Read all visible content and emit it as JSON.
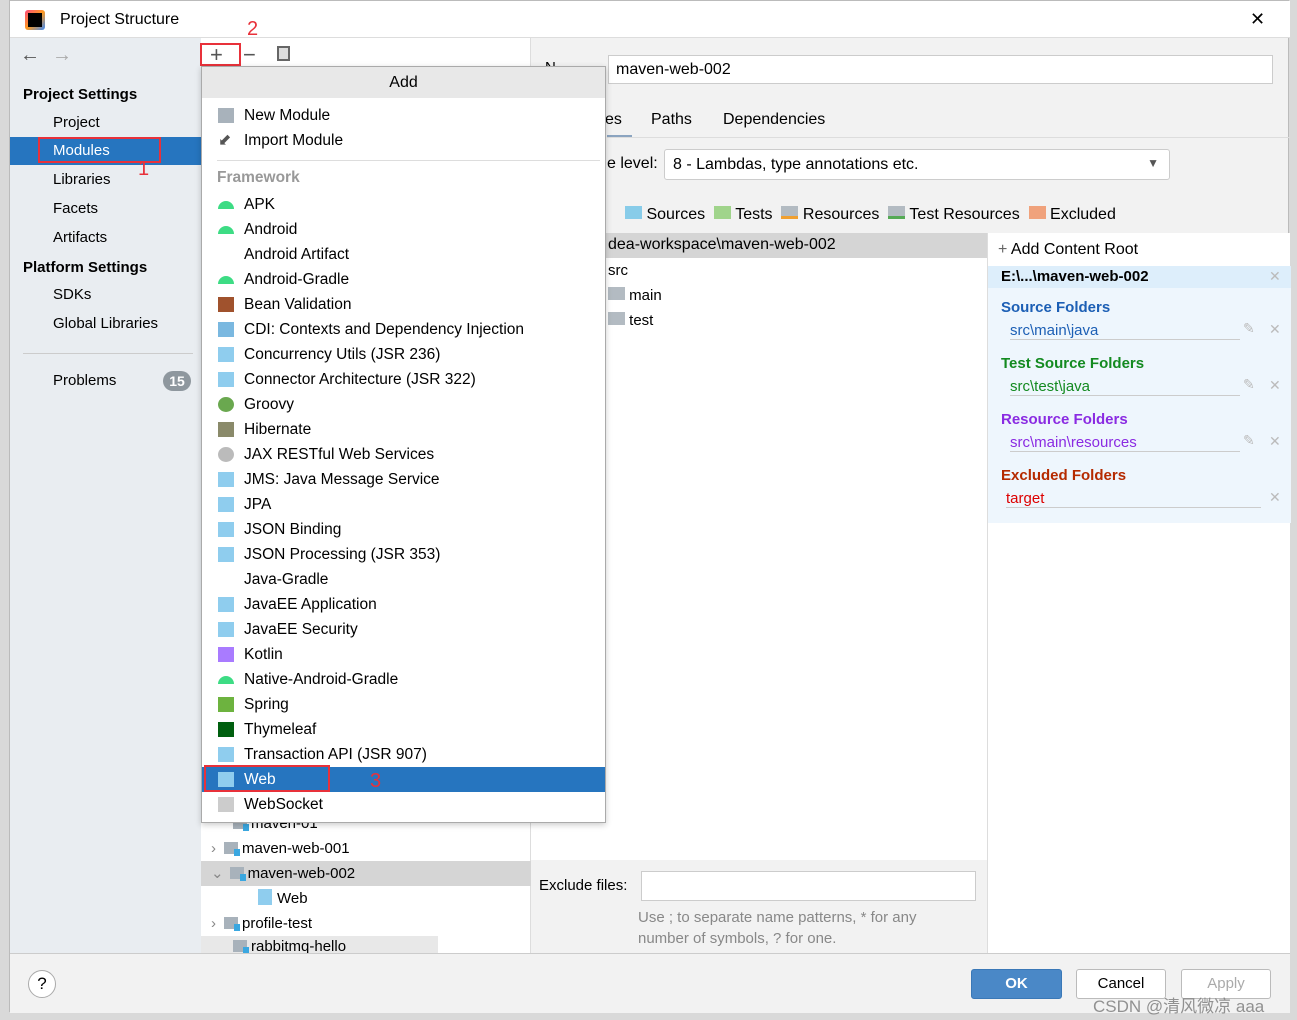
{
  "window": {
    "title": "Project Structure",
    "close": "✕"
  },
  "sidebar": {
    "project_settings": "Project Settings",
    "items": [
      "Project",
      "Modules",
      "Libraries",
      "Facets",
      "Artifacts"
    ],
    "platform_settings": "Platform Settings",
    "platform_items": [
      "SDKs",
      "Global Libraries"
    ],
    "problems": "Problems",
    "problems_count": "15",
    "selected": "Modules"
  },
  "toolbar": {
    "add": "+",
    "remove": "−",
    "copy": "copy"
  },
  "annotations": [
    "1",
    "2",
    "3"
  ],
  "popup": {
    "title": "Add",
    "top_items": [
      "New Module",
      "Import Module"
    ],
    "section": "Framework",
    "items": [
      {
        "label": "APK",
        "icon": "android-icon"
      },
      {
        "label": "Android",
        "icon": "android-icon"
      },
      {
        "label": "Android Artifact",
        "icon": ""
      },
      {
        "label": "Android-Gradle",
        "icon": "android-icon"
      },
      {
        "label": "Bean Validation",
        "icon": "bean-icon"
      },
      {
        "label": "CDI: Contexts and Dependency Injection",
        "icon": "cdi-icon"
      },
      {
        "label": "Concurrency Utils (JSR 236)",
        "icon": "javaee-icon"
      },
      {
        "label": "Connector Architecture (JSR 322)",
        "icon": "javaee-icon"
      },
      {
        "label": "Groovy",
        "icon": "groovy-icon"
      },
      {
        "label": "Hibernate",
        "icon": "hibernate-icon"
      },
      {
        "label": "JAX RESTful Web Services",
        "icon": "globe-icon"
      },
      {
        "label": "JMS: Java Message Service",
        "icon": "javaee-icon"
      },
      {
        "label": "JPA",
        "icon": "jpa-icon"
      },
      {
        "label": "JSON Binding",
        "icon": "javaee-icon"
      },
      {
        "label": "JSON Processing (JSR 353)",
        "icon": "javaee-icon"
      },
      {
        "label": "Java-Gradle",
        "icon": ""
      },
      {
        "label": "JavaEE Application",
        "icon": "javaee-icon"
      },
      {
        "label": "JavaEE Security",
        "icon": "javaee-icon"
      },
      {
        "label": "Kotlin",
        "icon": "kotlin-icon"
      },
      {
        "label": "Native-Android-Gradle",
        "icon": "android-icon"
      },
      {
        "label": "Spring",
        "icon": "spring-icon"
      },
      {
        "label": "Thymeleaf",
        "icon": "thymeleaf-icon"
      },
      {
        "label": "Transaction API (JSR 907)",
        "icon": "javaee-icon"
      },
      {
        "label": "Web",
        "icon": "web-icon"
      },
      {
        "label": "WebSocket",
        "icon": "websocket-icon"
      }
    ],
    "selected": "Web"
  },
  "tree": {
    "items": [
      "maven-01",
      "maven-web-001",
      "maven-web-002",
      "Web",
      "profile-test",
      "rabbitmq-hello"
    ]
  },
  "details": {
    "name_label": "N",
    "name_value": "maven-web-002",
    "tabs": [
      "es",
      "Paths",
      "Dependencies"
    ],
    "language_level_label": "e level:",
    "language_level_value": "8 - Lambdas, type annotations etc.",
    "mark_as": [
      "Sources",
      "Tests",
      "Resources",
      "Test Resources",
      "Excluded"
    ],
    "root_path": "dea-workspace\\maven-web-002",
    "folders": [
      "src",
      "main",
      "test"
    ],
    "exclude_label": "Exclude files:",
    "exclude_value": "",
    "exclude_hint_1": "Use ; to separate name patterns, * for any",
    "exclude_hint_2": "number of symbols, ? for one."
  },
  "content_root": {
    "add": "Add Content Root",
    "root": "E:\\...\\maven-web-002",
    "source_title": "Source Folders",
    "source_path": "src\\main\\java",
    "test_title": "Test Source Folders",
    "test_path": "src\\test\\java",
    "resource_title": "Resource Folders",
    "resource_path": "src\\main\\resources",
    "excluded_title": "Excluded Folders",
    "excluded_path": "target",
    "colors": {
      "source": "#1c5fb5",
      "test": "#138a20",
      "resource": "#8a2be2",
      "excluded": "#b52a00"
    }
  },
  "footer": {
    "help": "?",
    "ok": "OK",
    "cancel": "Cancel",
    "apply": "Apply",
    "watermark": "CSDN @清风微凉 aaa"
  }
}
